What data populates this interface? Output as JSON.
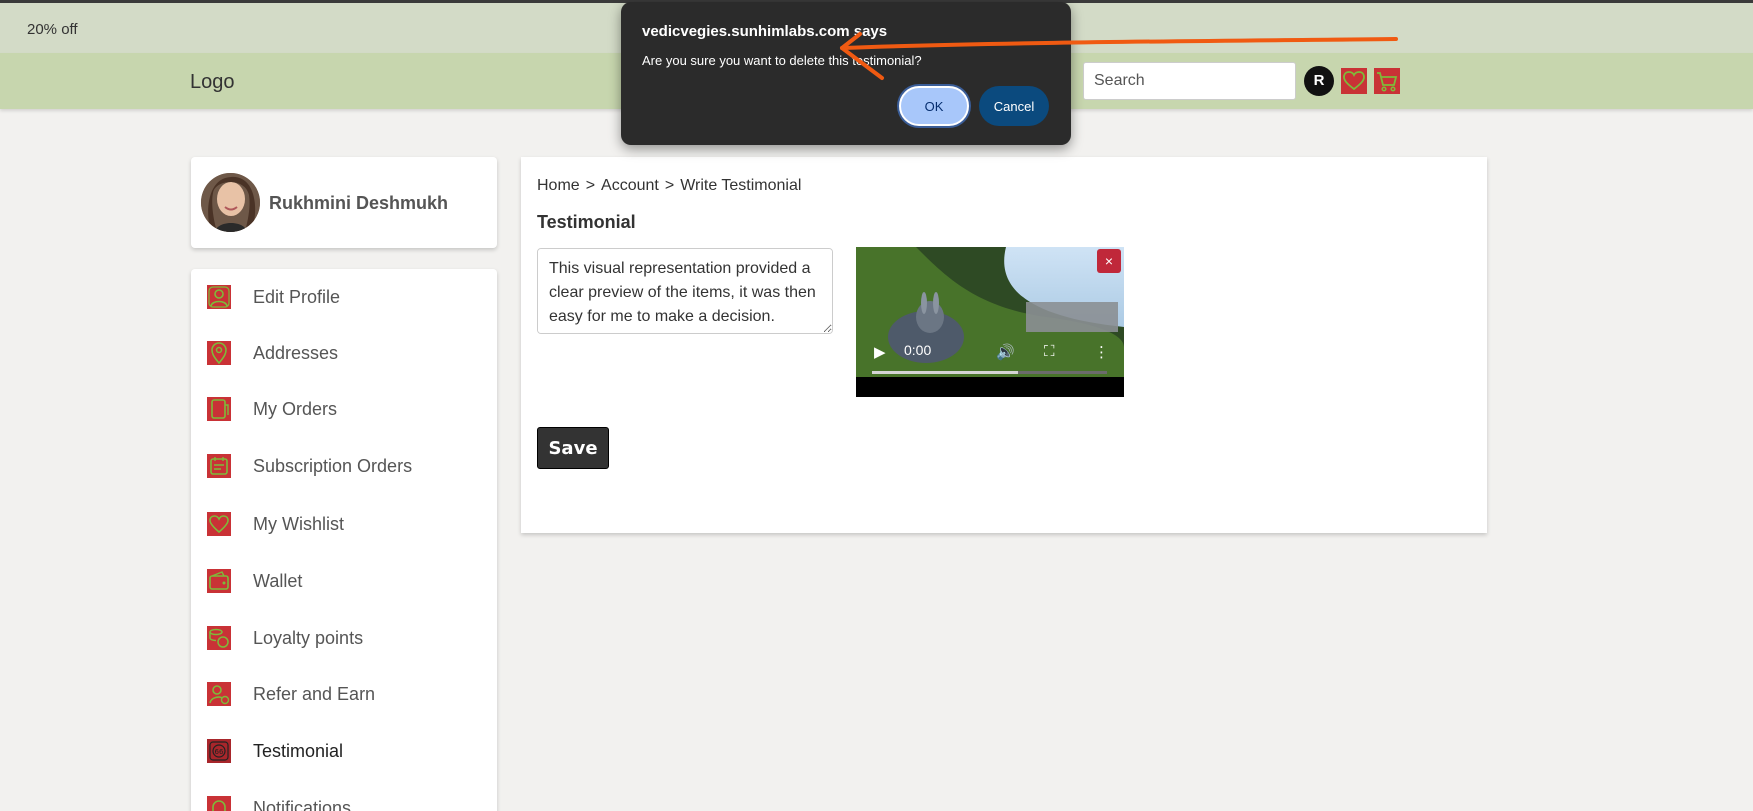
{
  "promo": {
    "text": "20% off"
  },
  "header": {
    "logo": "Logo",
    "search_placeholder": "Search",
    "user_initial": "R",
    "wishlist_icon": "heart-icon",
    "cart_icon": "cart-icon"
  },
  "profile": {
    "name": "Rukhmini Deshmukh"
  },
  "sidebar": {
    "items": [
      {
        "label": "Edit Profile",
        "icon": "user-icon"
      },
      {
        "label": "Addresses",
        "icon": "location-pin-icon"
      },
      {
        "label": "My Orders",
        "icon": "orders-icon"
      },
      {
        "label": "Subscription Orders",
        "icon": "subscription-icon"
      },
      {
        "label": "My Wishlist",
        "icon": "heart-icon"
      },
      {
        "label": "Wallet",
        "icon": "wallet-icon"
      },
      {
        "label": "Loyalty points",
        "icon": "coins-icon"
      },
      {
        "label": "Refer and Earn",
        "icon": "refer-icon"
      },
      {
        "label": "Testimonial",
        "icon": "quote-icon",
        "active": true
      },
      {
        "label": "Notifications",
        "icon": "bell-icon"
      }
    ]
  },
  "content": {
    "breadcrumb": {
      "home": "Home",
      "account": "Account",
      "current": "Write Testimonial",
      "separator": ">"
    },
    "section_title": "Testimonial",
    "testimonial_text": "This visual representation provided a clear preview of the items, it was then easy for me to make a decision.",
    "video": {
      "time": "0:00",
      "progress": 0.62
    },
    "remove_label": "×",
    "save_label": "Save"
  },
  "dialog": {
    "title": "vedicvegies.sunhimlabs.com says",
    "message": "Are you sure you want to delete this testimonial?",
    "ok_label": "OK",
    "cancel_label": "Cancel"
  },
  "colors": {
    "promo_bg": "#d3dbc7",
    "header_bg": "#c7d6ae",
    "icon_red": "#c93236",
    "icon_green": "#7dbb3a",
    "annotation_arrow": "#f05a12"
  }
}
